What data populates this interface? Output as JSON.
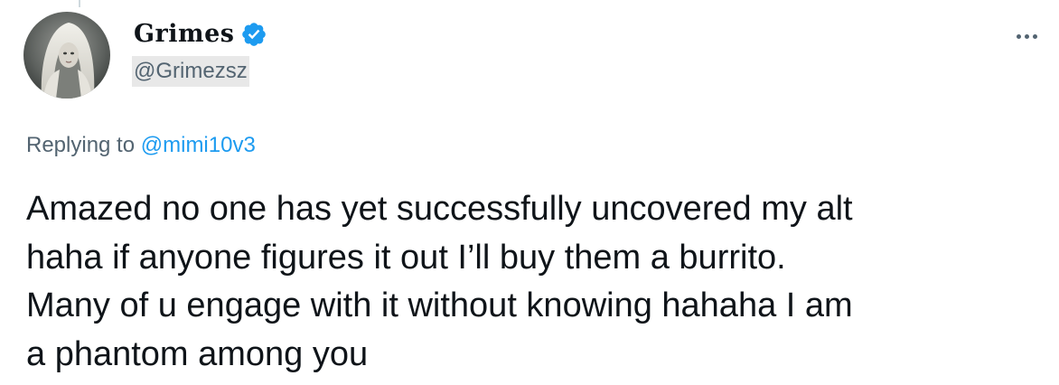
{
  "author": {
    "display_name": "Grimes",
    "handle": "@Grimezsz",
    "verified": true,
    "avatar_icon": "hooded-figure-avatar"
  },
  "menu": {
    "icon": "more-icon"
  },
  "reply": {
    "prefix": "Replying to",
    "mention": "@mimi10v3"
  },
  "tweet": {
    "lines": [
      "Amazed no one has yet successfully uncovered my alt",
      "haha if anyone figures it out I’ll buy them a burrito.",
      "Many of u engage with it without knowing hahaha I am",
      "a phantom among you"
    ]
  },
  "colors": {
    "text_primary": "#0f1419",
    "text_secondary": "#536471",
    "accent": "#1d9bf0",
    "handle_highlight": "#e8e8e8"
  }
}
